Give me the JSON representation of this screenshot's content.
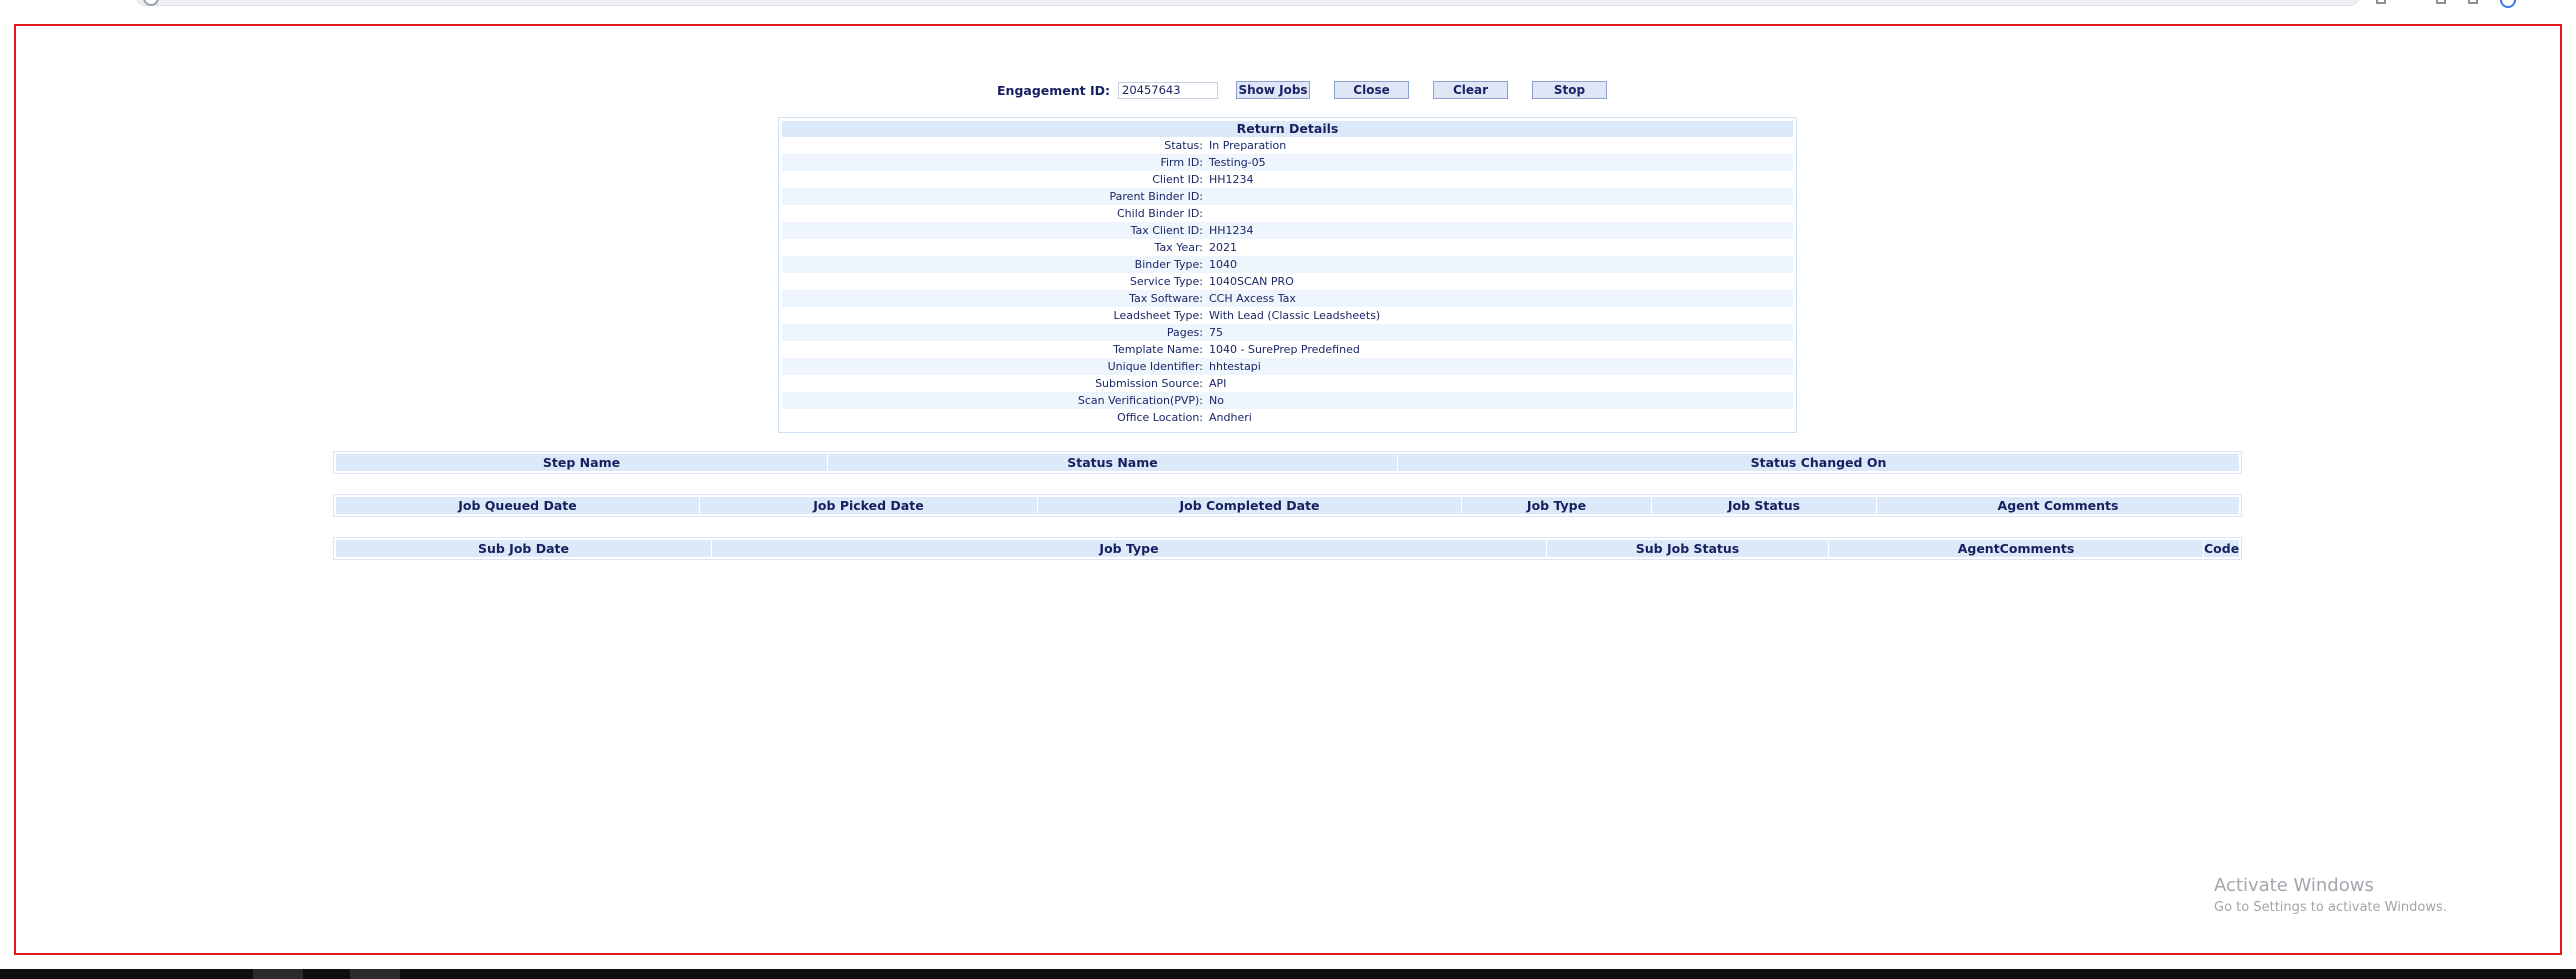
{
  "engagement": {
    "label": "Engagement ID:",
    "value": "20457643",
    "buttons": {
      "show_jobs": "Show Jobs",
      "close": "Close",
      "clear": "Clear",
      "stop": "Stop"
    }
  },
  "return_details": {
    "title": "Return Details",
    "rows": [
      {
        "label": "Status:",
        "value": "In Preparation"
      },
      {
        "label": "Firm ID:",
        "value": "Testing-05"
      },
      {
        "label": "Client ID:",
        "value": "HH1234"
      },
      {
        "label": "Parent Binder ID:",
        "value": ""
      },
      {
        "label": "Child Binder ID:",
        "value": ""
      },
      {
        "label": "Tax Client ID:",
        "value": "HH1234"
      },
      {
        "label": "Tax Year:",
        "value": "2021"
      },
      {
        "label": "Binder Type:",
        "value": "1040"
      },
      {
        "label": "Service Type:",
        "value": "1040SCAN PRO"
      },
      {
        "label": "Tax Software:",
        "value": "CCH Axcess Tax"
      },
      {
        "label": "Leadsheet Type:",
        "value": "With Lead (Classic Leadsheets)"
      },
      {
        "label": "Pages:",
        "value": "75"
      },
      {
        "label": "Template Name:",
        "value": "1040 - SurePrep Predefined"
      },
      {
        "label": "Unique Identifier:",
        "value": "hhtestapi"
      },
      {
        "label": "Submission Source:",
        "value": "API"
      },
      {
        "label": "Scan Verification(PVP):",
        "value": "No"
      },
      {
        "label": "Office Location:",
        "value": "Andheri"
      }
    ]
  },
  "steps_grid": {
    "columns": [
      "Step Name",
      "Status Name",
      "Status Changed On"
    ]
  },
  "jobs_grid": {
    "columns": [
      "Job Queued Date",
      "Job Picked Date",
      "Job Completed Date",
      "Job Type",
      "Job Status",
      "Agent Comments"
    ]
  },
  "subjobs_grid": {
    "columns": [
      "Sub Job Date",
      "Job Type",
      "Sub Job Status",
      "AgentComments",
      "Code"
    ]
  },
  "watermark": {
    "title": "Activate Windows",
    "subtitle": "Go to Settings to activate Windows."
  },
  "colors": {
    "frame_border": "#e0181b",
    "header_bg": "#dce9f8",
    "text": "#17205e"
  }
}
